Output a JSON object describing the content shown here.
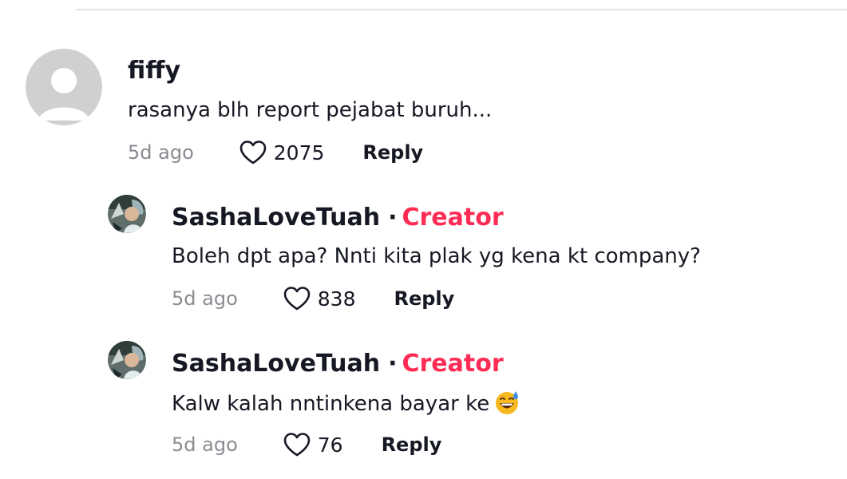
{
  "comments": [
    {
      "username": "fiffy",
      "text": "rasanya blh report pejabat buruh...",
      "time": "5d ago",
      "likes": "2075",
      "reply_label": "Reply"
    }
  ],
  "replies": [
    {
      "username": "SashaLoveTuah",
      "separator": "·",
      "badge": "Creator",
      "text": "Boleh dpt apa? Nnti kita plak yg kena kt company?",
      "time": "5d ago",
      "likes": "838",
      "reply_label": "Reply"
    },
    {
      "username": "SashaLoveTuah",
      "separator": "·",
      "badge": "Creator",
      "text": "Kalw kalah nntinkena bayar ke",
      "emoji": "sweat-smile-emoji",
      "time": "5d ago",
      "likes": "76",
      "reply_label": "Reply"
    }
  ],
  "colors": {
    "creator_badge": "#fe2c55",
    "muted_text": "#8a8b91",
    "primary_text": "#161823"
  }
}
